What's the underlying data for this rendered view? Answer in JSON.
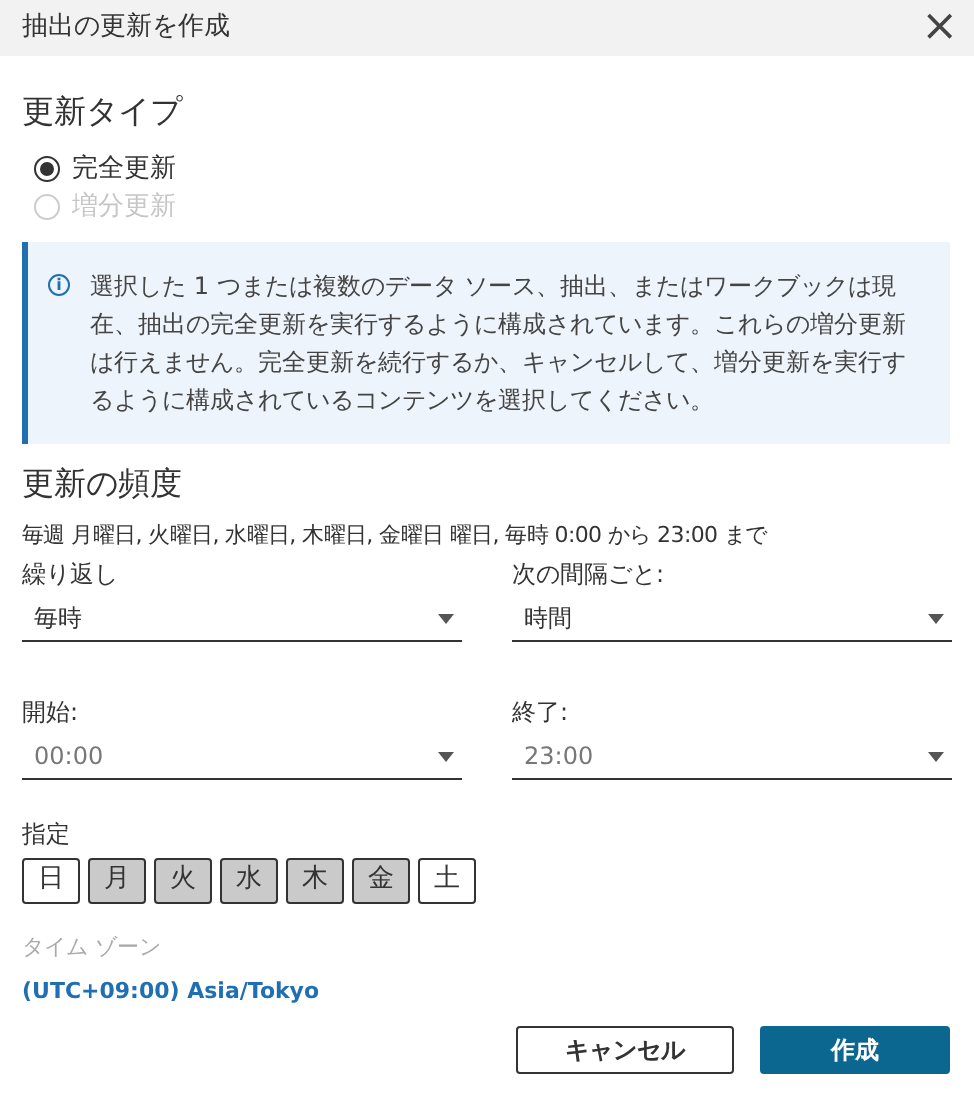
{
  "window": {
    "title": "抽出の更新を作成",
    "close": "×"
  },
  "refresh_type": {
    "heading": "更新タイプ",
    "options": [
      {
        "label": "完全更新",
        "selected": true,
        "disabled": false
      },
      {
        "label": "増分更新",
        "selected": false,
        "disabled": true
      }
    ]
  },
  "info": {
    "icon": "i",
    "text": "選択した 1 つまたは複数のデータ ソース、抽出、またはワークブックは現在、抽出の完全更新を実行するように構成されています。これらの増分更新は行えません。完全更新を続行するか、キャンセルして、増分更新を実行するように構成されているコンテンツを選択してください。"
  },
  "frequency": {
    "heading": "更新の頻度",
    "summary": "毎週 月曜日, 火曜日, 水曜日, 木曜日, 金曜日 曜日, 毎時 0:00 から 23:00 まで",
    "fields": [
      {
        "label": "繰り返し",
        "value": "毎時",
        "muted": false
      },
      {
        "label": "次の間隔ごと:",
        "value": "時間",
        "muted": false
      },
      {
        "label": "開始:",
        "value": "00:00",
        "muted": true
      },
      {
        "label": "終了:",
        "value": "23:00",
        "muted": true
      }
    ],
    "days_label": "指定",
    "days": [
      {
        "label": "日",
        "selected": false
      },
      {
        "label": "月",
        "selected": true
      },
      {
        "label": "火",
        "selected": true
      },
      {
        "label": "水",
        "selected": true
      },
      {
        "label": "木",
        "selected": true
      },
      {
        "label": "金",
        "selected": true
      },
      {
        "label": "土",
        "selected": false
      }
    ]
  },
  "timezone": {
    "label": "タイム ゾーン",
    "value": "(UTC+09:00) Asia/Tokyo"
  },
  "buttons": {
    "cancel": "キャンセル",
    "create": "作成"
  }
}
